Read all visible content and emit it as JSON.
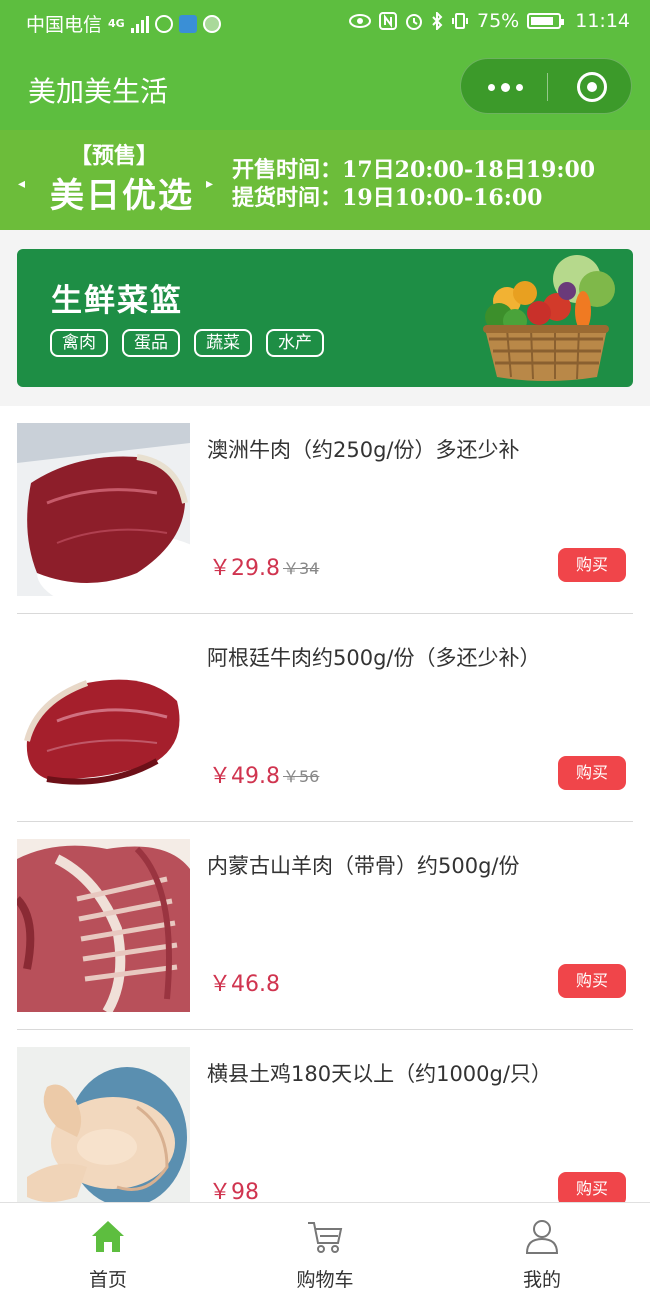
{
  "status_bar": {
    "carrier": "中国电信",
    "network": "4G",
    "battery": "75%",
    "time": "11:14"
  },
  "title_bar": {
    "title": "美加美生活",
    "capsule_icons": [
      "more-dots-icon",
      "target-circle-icon"
    ]
  },
  "presale_banner": {
    "tag": "【预售】",
    "name": "美日优选",
    "sale_time_label": "开售时间：",
    "sale_time": "17日20:00-18日19:00",
    "pickup_time_label": "提货时间：",
    "pickup_time": "19日10:00-16:00"
  },
  "category_banner": {
    "title": "生鲜菜篮",
    "tags": [
      "禽肉",
      "蛋品",
      "蔬菜",
      "水产"
    ]
  },
  "products": [
    {
      "name": "澳洲牛肉（约250g/份）多还少补",
      "price": "￥29.8",
      "old_price": "￥34",
      "buy_label": "购买"
    },
    {
      "name": "阿根廷牛肉约500g/份（多还少补）",
      "price": "￥49.8",
      "old_price": "￥56",
      "buy_label": "购买"
    },
    {
      "name": "内蒙古山羊肉（带骨）约500g/份",
      "price": "￥46.8",
      "old_price": "",
      "buy_label": "购买"
    },
    {
      "name": "横县土鸡180天以上（约1000g/只）",
      "price": "￥98",
      "old_price": "",
      "buy_label": "购买"
    }
  ],
  "tab_bar": {
    "tabs": [
      {
        "label": "首页",
        "icon": "home-icon",
        "active": true
      },
      {
        "label": "购物车",
        "icon": "cart-icon",
        "active": false
      },
      {
        "label": "我的",
        "icon": "user-icon",
        "active": false
      }
    ]
  },
  "colors": {
    "brand_green": "#5dbe3f",
    "banner_green": "#1e8e45",
    "price_red": "#d0344f",
    "buy_button": "#f0454a"
  }
}
